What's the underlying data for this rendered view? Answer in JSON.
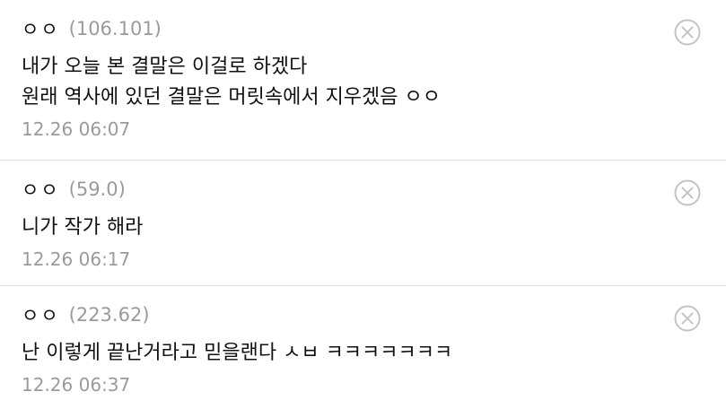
{
  "comments": [
    {
      "nickname": "ㅇㅇ",
      "ip": "(106.101)",
      "body": "내가 오늘 본 결말은 이걸로 하겠다\n원래 역사에 있던 결말은 머릿속에서 지우겠음 ㅇㅇ",
      "time": "12.26 06:07"
    },
    {
      "nickname": "ㅇㅇ",
      "ip": "(59.0)",
      "body": "니가 작가 해라",
      "time": "12.26 06:17"
    },
    {
      "nickname": "ㅇㅇ",
      "ip": "(223.62)",
      "body": "난 이렇게 끝난거라고 믿을랜다 ㅅㅂ ㅋㅋㅋㅋㅋㅋㅋ",
      "time": "12.26 06:37"
    }
  ],
  "icons": {
    "delete": "close-circle-icon"
  },
  "colors": {
    "text": "#111111",
    "meta": "#9a9a9a",
    "divider": "#dcdde8",
    "icon": "#c4c4c8"
  }
}
